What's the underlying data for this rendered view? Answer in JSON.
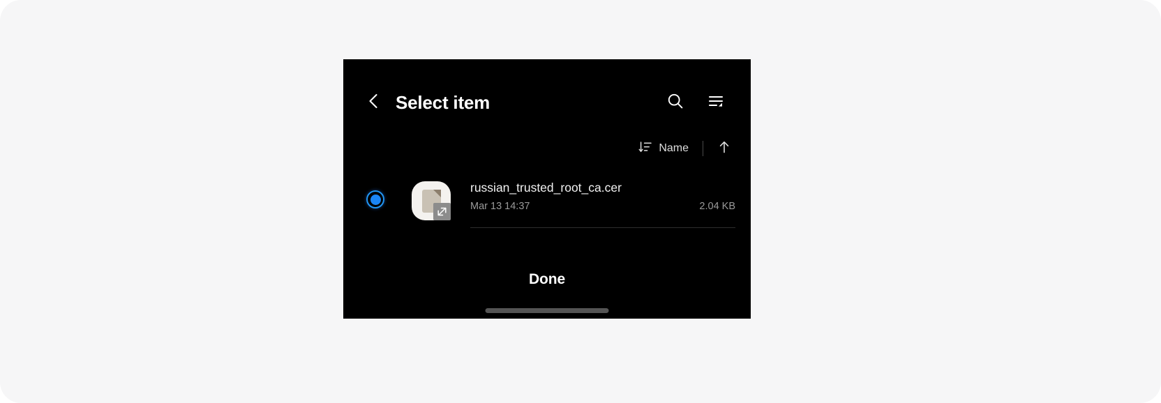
{
  "header": {
    "back_icon": "chevron-left-icon",
    "title": "Select item",
    "search_icon": "search-icon",
    "view_mode_icon": "list-view-icon"
  },
  "sort_bar": {
    "sort_icon": "sort-descending-icon",
    "field_label": "Name",
    "direction_icon": "arrow-up-icon"
  },
  "file_list": {
    "items": [
      {
        "selected": true,
        "radio_icon": "radio-selected-icon",
        "thumb_icon": "certificate-file-icon",
        "name": "russian_trusted_root_ca.cer",
        "date": "Mar 13 14:37",
        "size": "2.04 KB"
      }
    ]
  },
  "bottom_bar": {
    "done_label": "Done"
  },
  "system": {
    "gesture_pill": "home-gesture-pill"
  },
  "colors": {
    "canvas_background": "#f6f6f7",
    "panel_background": "#000000",
    "accent_blue": "#1a85f5",
    "primary_text": "#ffffff",
    "secondary_text": "#9a9a9a",
    "divider": "#2e2e2e"
  }
}
